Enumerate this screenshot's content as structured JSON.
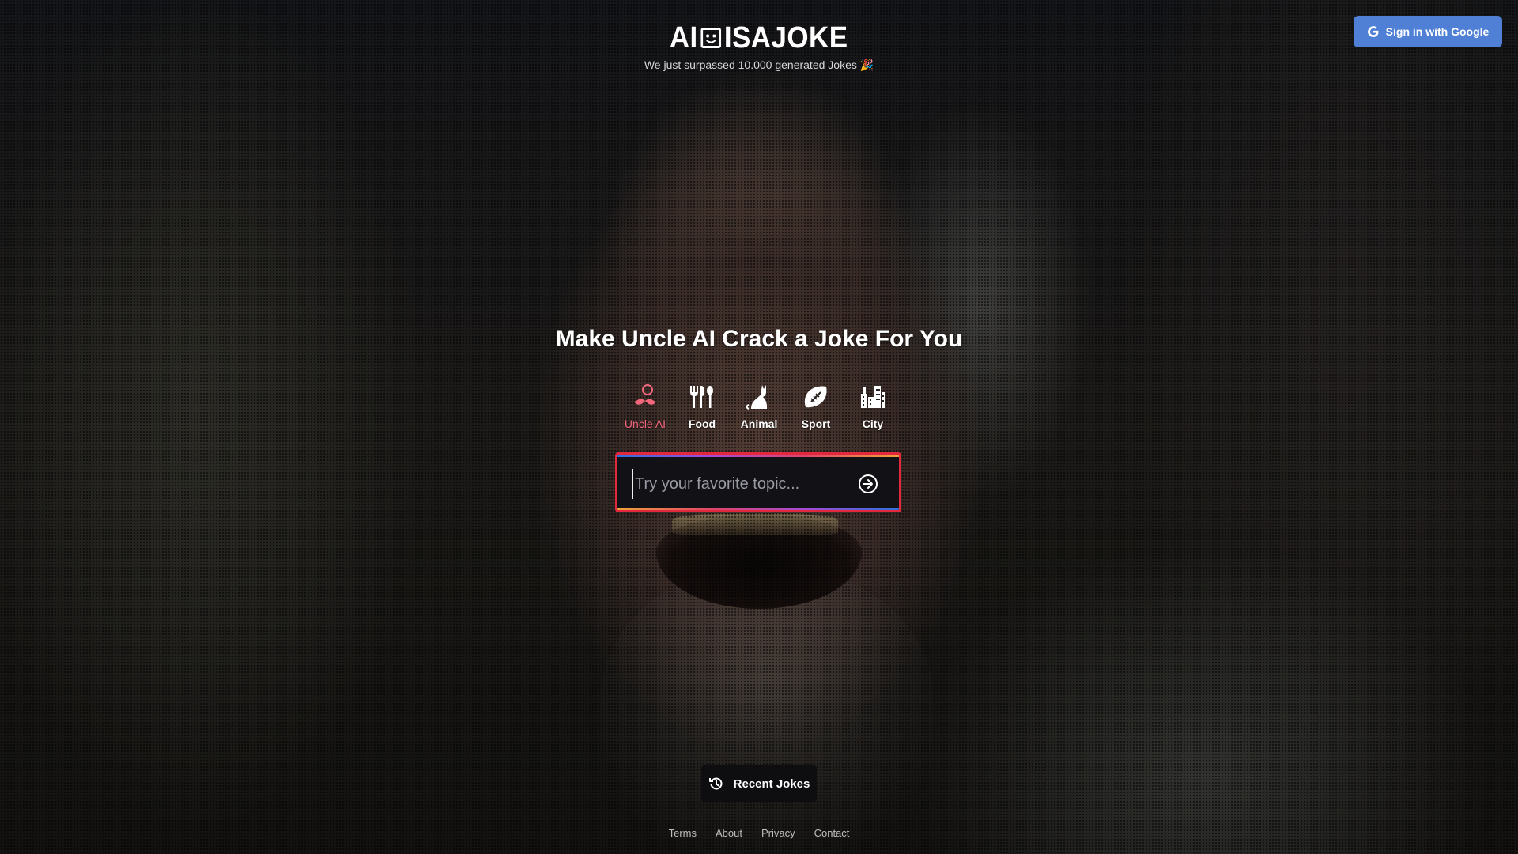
{
  "header": {
    "logo_left": "AI",
    "logo_right": "ISAJOKE",
    "tagline": "We just surpassed 10.000 generated Jokes 🎉",
    "signin_label": "Sign in with Google"
  },
  "hero": {
    "headline": "Make Uncle AI Crack a Joke For You"
  },
  "categories": [
    {
      "label": "Uncle AI",
      "icon": "mustache-person-icon",
      "active": true
    },
    {
      "label": "Food",
      "icon": "cutlery-icon",
      "active": false
    },
    {
      "label": "Animal",
      "icon": "cat-icon",
      "active": false
    },
    {
      "label": "Sport",
      "icon": "football-icon",
      "active": false
    },
    {
      "label": "City",
      "icon": "city-buildings-icon",
      "active": false
    }
  ],
  "search": {
    "placeholder": "Try your favorite topic...",
    "value": ""
  },
  "recent": {
    "label": "Recent Jokes"
  },
  "footer": {
    "links": [
      "Terms",
      "About",
      "Privacy",
      "Contact"
    ]
  },
  "colors": {
    "accent": "#f2677b",
    "google_button": "#4f80d6",
    "search_border": "#e1283d"
  }
}
